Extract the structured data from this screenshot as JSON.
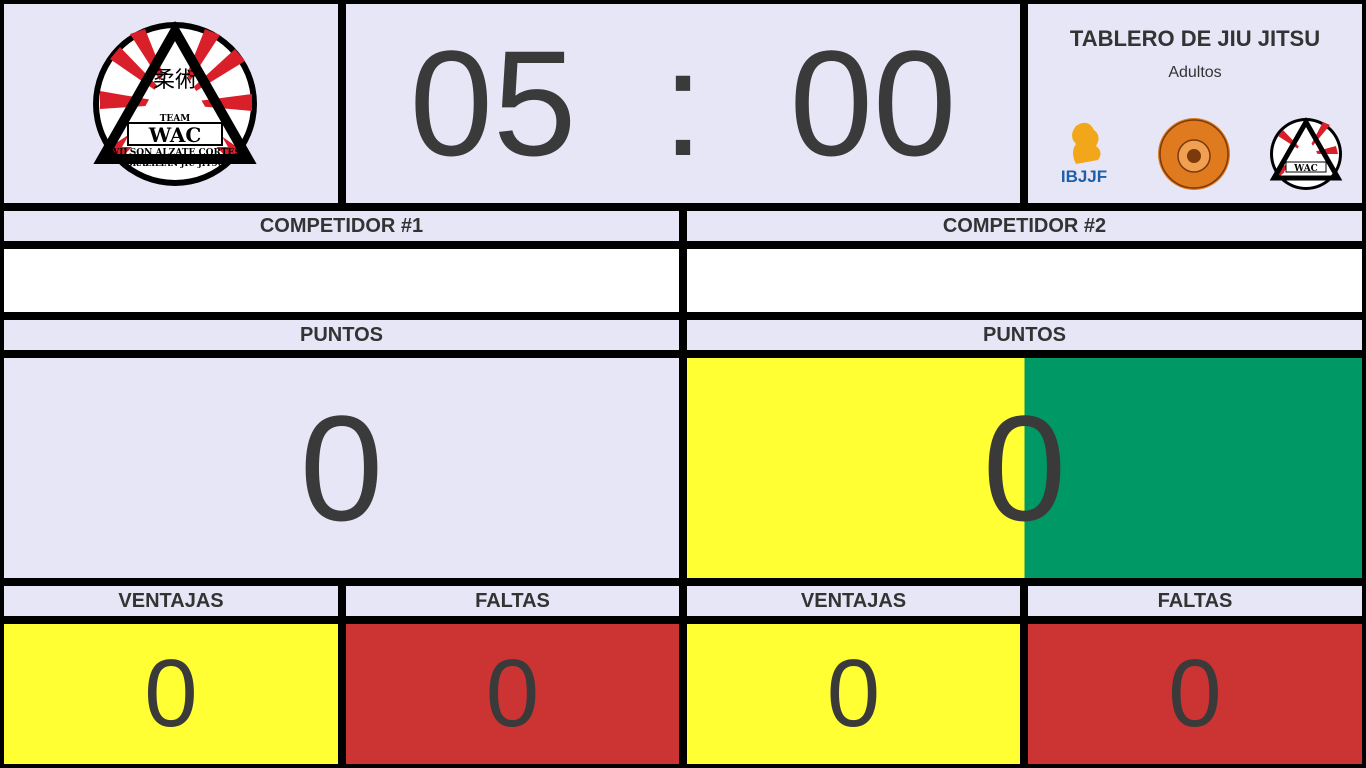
{
  "logo": {
    "team_text": "TEAM",
    "brand": "WAC",
    "name": "WILSON ALZATE CORTES",
    "sub": "BRAZILIAN JIU JITSU",
    "kanji": "柔術"
  },
  "timer": {
    "minutes": "05",
    "separator": ":",
    "seconds": "00"
  },
  "info": {
    "title": "TABLERO DE JIU JITSU",
    "category": "Adultos",
    "logos": [
      {
        "name": "ibjjf-logo",
        "text": "IBJJF"
      },
      {
        "name": "kanji-de-luiz-logo",
        "text": "CLUBE KANJI DE LUIZ"
      },
      {
        "name": "wac-small-logo",
        "text": "WAC"
      }
    ]
  },
  "competitor1": {
    "header": "COMPETIDOR #1",
    "name": "",
    "points_label": "PUNTOS",
    "points": "0",
    "advantages_label": "VENTAJAS",
    "advantages": "0",
    "penalties_label": "FALTAS",
    "penalties": "0"
  },
  "competitor2": {
    "header": "COMPETIDOR #2",
    "name": "",
    "points_label": "PUNTOS",
    "points": "0",
    "advantages_label": "VENTAJAS",
    "advantages": "0",
    "penalties_label": "FALTAS",
    "penalties": "0"
  },
  "colors": {
    "panel": "#e6e6f7",
    "yellow": "#ffff33",
    "green": "#009966",
    "red": "#cc3333",
    "border": "#000000"
  }
}
